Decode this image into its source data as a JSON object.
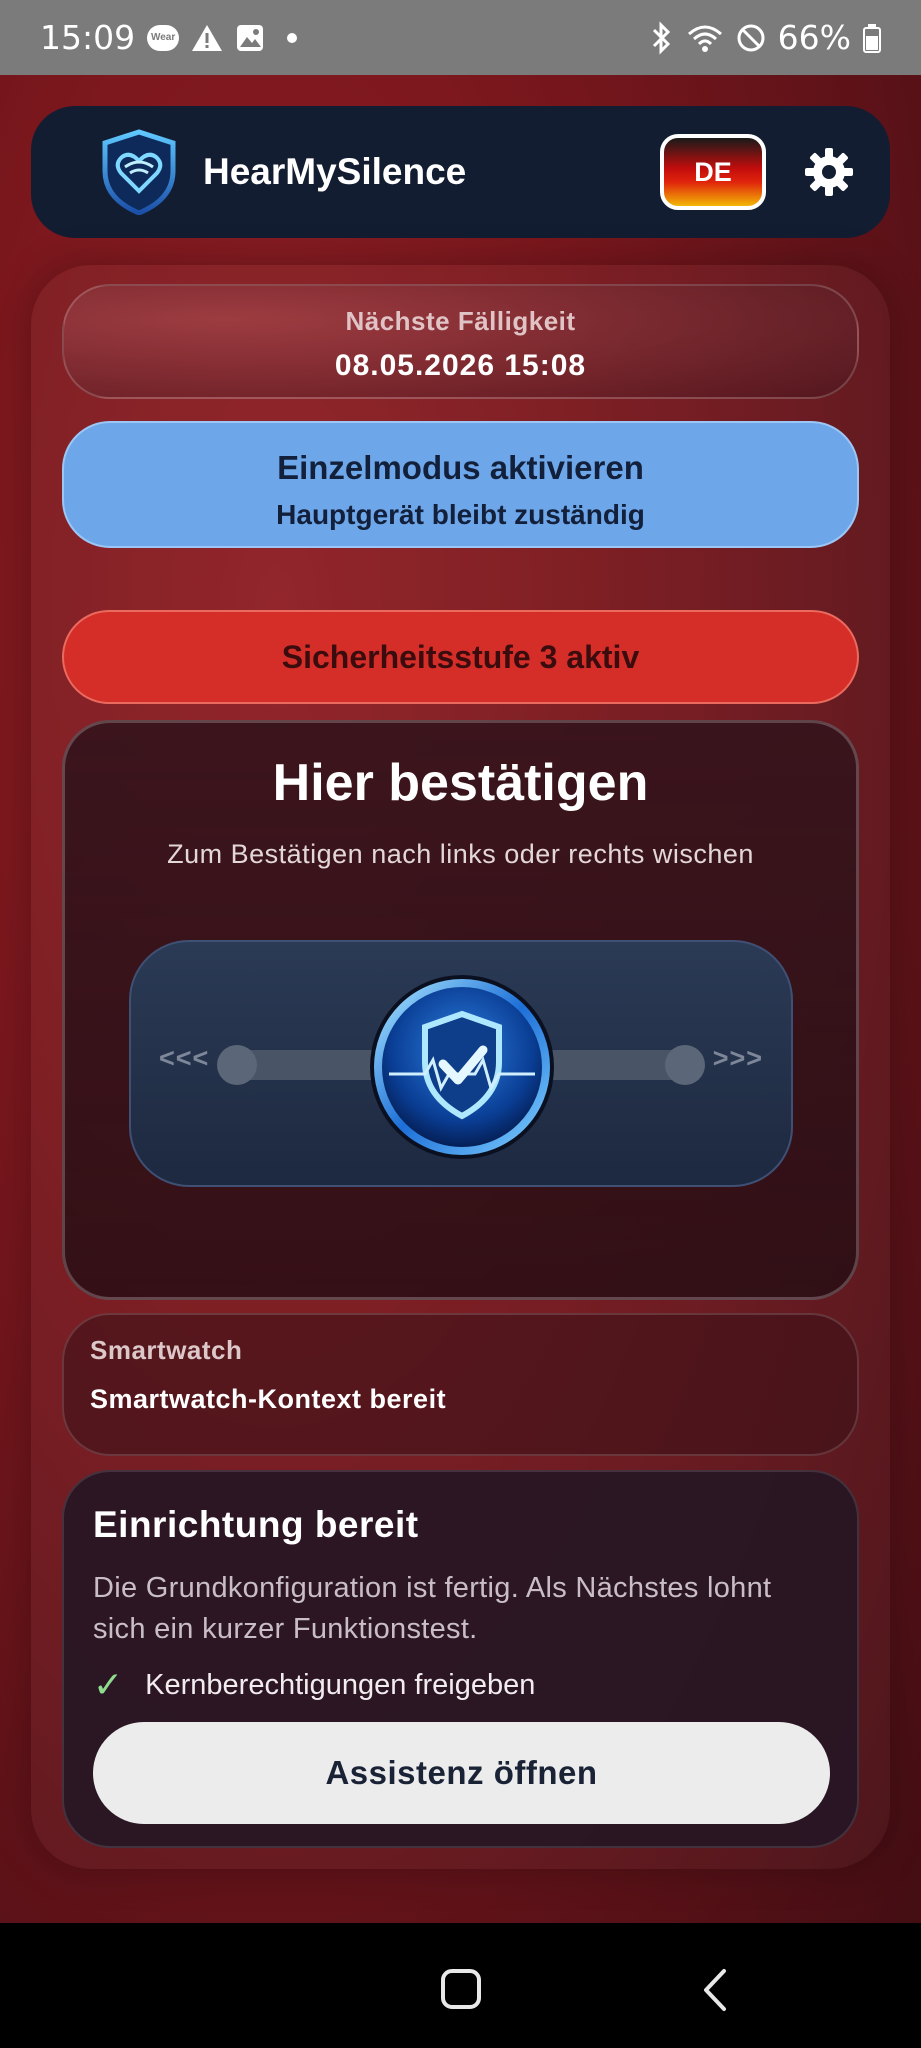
{
  "status_bar": {
    "time": "15:09",
    "wear_badge": "Wear",
    "battery": "66%",
    "left_icons": [
      "wear-icon",
      "warning-icon",
      "image-icon",
      "dot-icon"
    ],
    "right_icons": [
      "bluetooth-icon",
      "wifi-icon",
      "do-not-disturb-icon",
      "battery-icon"
    ]
  },
  "header": {
    "title": "HearMySilence",
    "language": "DE",
    "logo_icon": "shield-heart-icon",
    "settings_icon": "gear-icon"
  },
  "due": {
    "label": "Nächste Fälligkeit",
    "value": "08.05.2026 15:08"
  },
  "single_mode": {
    "title": "Einzelmodus aktivieren",
    "subtitle": "Hauptgerät bleibt zuständig"
  },
  "security_level": {
    "label": "Sicherheitsstufe 3 aktiv"
  },
  "confirm": {
    "title": "Hier bestätigen",
    "subtitle": "Zum Bestätigen nach links oder rechts wischen",
    "left_arrows": "<<<",
    "right_arrows": ">>>",
    "handle_icon": "shield-check-heartbeat-icon"
  },
  "smartwatch": {
    "label": "Smartwatch",
    "value": "Smartwatch-Kontext bereit"
  },
  "setup": {
    "title": "Einrichtung bereit",
    "description": "Die Grundkonfiguration ist fertig. Als Nächstes lohnt sich ein kurzer Funktionstest.",
    "check_item": "Kernberechtigungen freigeben",
    "button": "Assistenz öffnen"
  },
  "nav": {
    "home_icon": "home-square-icon",
    "back_icon": "back-chevron-icon"
  },
  "colors": {
    "background": "#7a171d",
    "header": "#131d31",
    "single_mode": "#6ea7e9",
    "security_level": "#d52e29",
    "button_light": "#ececec"
  }
}
